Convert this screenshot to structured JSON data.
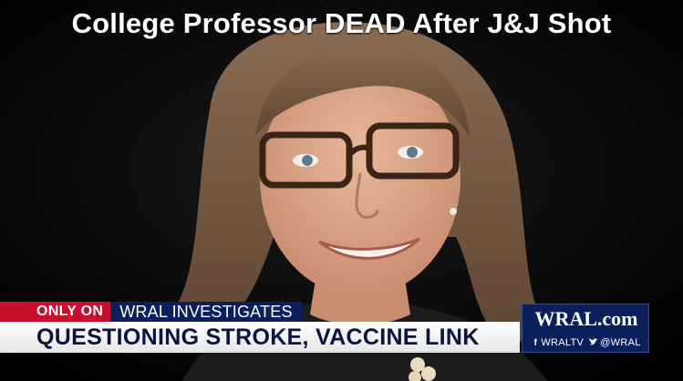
{
  "headline": "College Professor DEAD After J&J Shot",
  "lower_third": {
    "only_on": "ONLY ON",
    "segment": "WRAL INVESTIGATES",
    "banner": "QUESTIONING STROKE, VACCINE LINK"
  },
  "brand": {
    "logo": "WRAL.com",
    "facebook": "WRALTV",
    "twitter": "@WRAL"
  },
  "colors": {
    "only_on_bg": "#c8102e",
    "segment_bg": "#0a1f5c",
    "banner_text": "#0b1440"
  }
}
